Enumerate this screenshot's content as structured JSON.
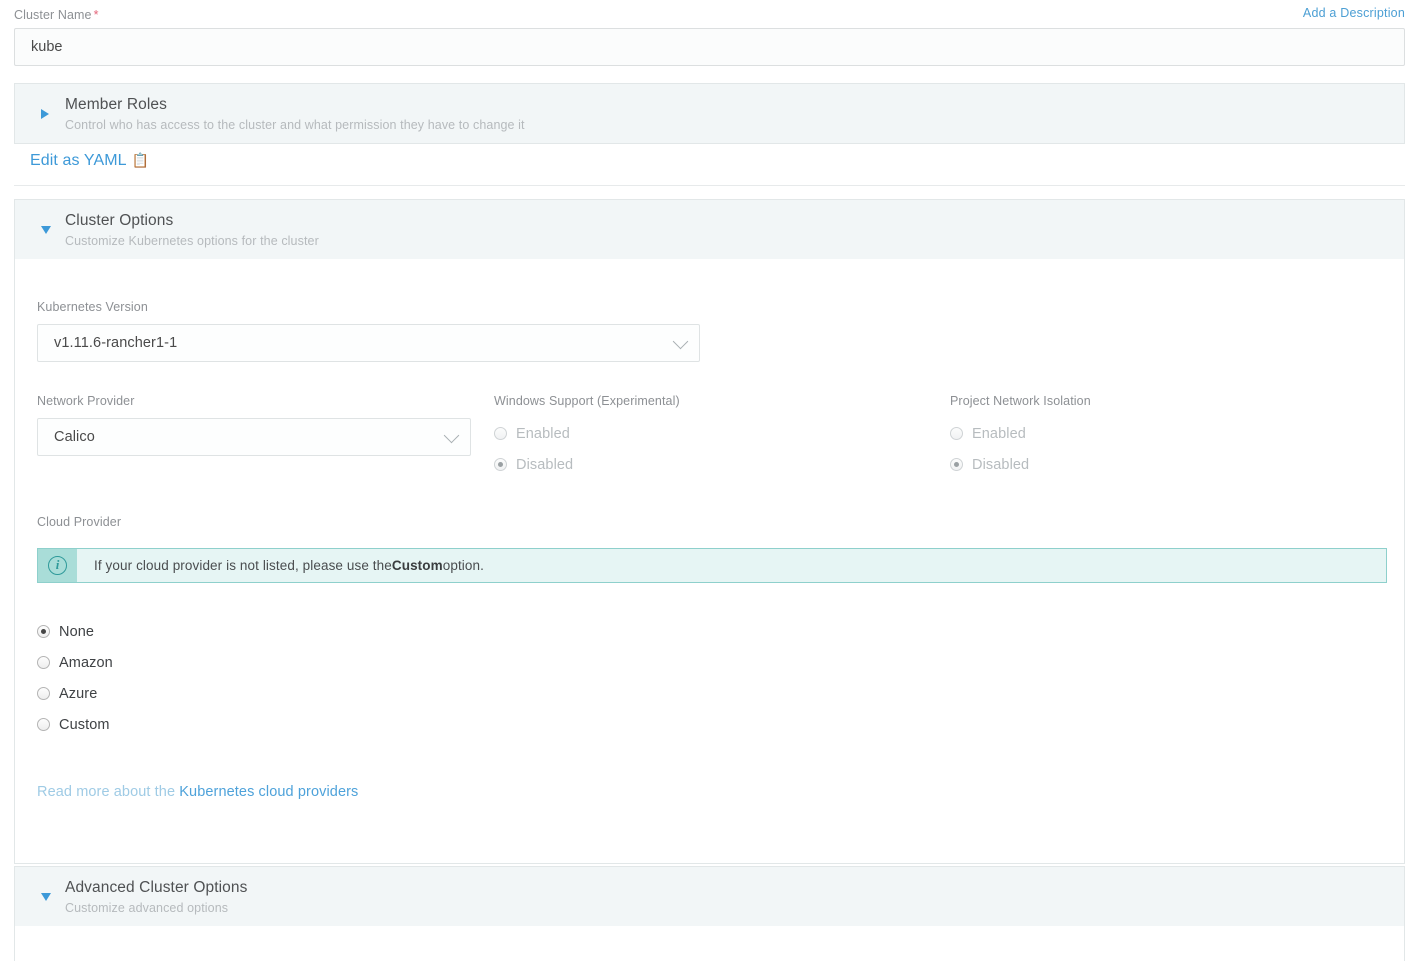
{
  "cluster_name": {
    "label": "Cluster Name",
    "required_marker": "*",
    "value": "kube",
    "add_description_link": "Add a Description"
  },
  "member_roles": {
    "title": "Member Roles",
    "subtitle": "Control who has access to the cluster and what permission they have to change it",
    "expanded": false
  },
  "yaml": {
    "label": "Edit as YAML",
    "icon": "clipboard-icon",
    "glyph": "Ὄb"
  },
  "cluster_options": {
    "title": "Cluster Options",
    "subtitle": "Customize Kubernetes options for the cluster",
    "expanded": true,
    "kubernetes_version": {
      "label": "Kubernetes Version",
      "value": "v1.11.6-rancher1-1"
    },
    "network_provider": {
      "label": "Network Provider",
      "value": "Calico"
    },
    "windows_support": {
      "label": "Windows Support (Experimental)",
      "options": [
        "Enabled",
        "Disabled"
      ],
      "selected": "Disabled",
      "disabled": true
    },
    "project_network_isolation": {
      "label": "Project Network Isolation",
      "options": [
        "Enabled",
        "Disabled"
      ],
      "selected": "Disabled",
      "disabled": true
    },
    "cloud_provider": {
      "label": "Cloud Provider",
      "banner": {
        "icon": "info-icon",
        "text_before": "If your cloud provider is not listed, please use the ",
        "emphasis": "Custom",
        "text_after": " option."
      },
      "options": [
        "None",
        "Amazon",
        "Azure",
        "Custom"
      ],
      "selected": "None",
      "readmore_prefix": "Read more about the ",
      "readmore_link": "Kubernetes cloud providers"
    }
  },
  "advanced_cluster_options": {
    "title": "Advanced Cluster Options",
    "subtitle": "Customize advanced options",
    "expanded": true
  },
  "colors": {
    "link_blue": "#3d99d8",
    "caret_blue": "#3d99d8",
    "banner_bg": "#e6f5f4",
    "banner_accent": "#a9ddd8",
    "banner_border": "#8ed0cc",
    "required_red": "#e4657a",
    "panel_header_bg": "#f2f6f7"
  }
}
